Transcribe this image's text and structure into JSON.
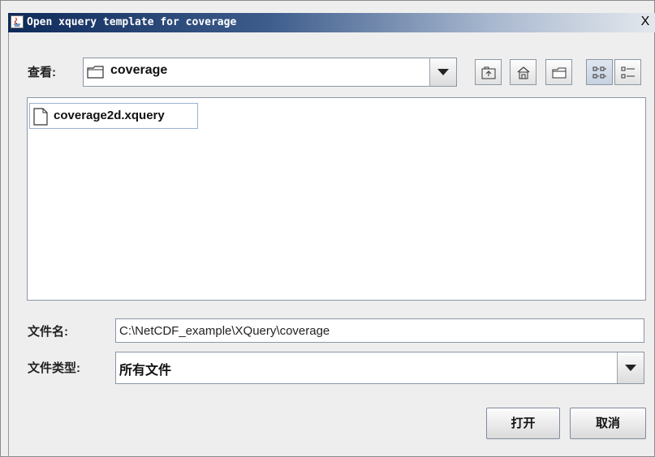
{
  "window": {
    "title": "Open xquery template for coverage",
    "close_glyph": "X"
  },
  "look_in": {
    "label": "查看:",
    "value": "coverage",
    "icon": "folder-icon",
    "toolbar": [
      {
        "name": "up-one-level-button",
        "icon": "up-folder-icon"
      },
      {
        "name": "home-button",
        "icon": "home-icon"
      },
      {
        "name": "new-folder-button",
        "icon": "new-folder-icon"
      },
      {
        "name": "list-view-button",
        "icon": "list-view-icon",
        "selected": true
      },
      {
        "name": "details-view-button",
        "icon": "details-view-icon"
      }
    ]
  },
  "files": [
    {
      "name": "coverage2d.xquery",
      "icon": "file-icon"
    }
  ],
  "file_name": {
    "label": "文件名:",
    "value": "C:\\NetCDF_example\\XQuery\\coverage"
  },
  "file_type": {
    "label": "文件类型:",
    "value": "所有文件"
  },
  "buttons": {
    "open": "打开",
    "cancel": "取消"
  }
}
